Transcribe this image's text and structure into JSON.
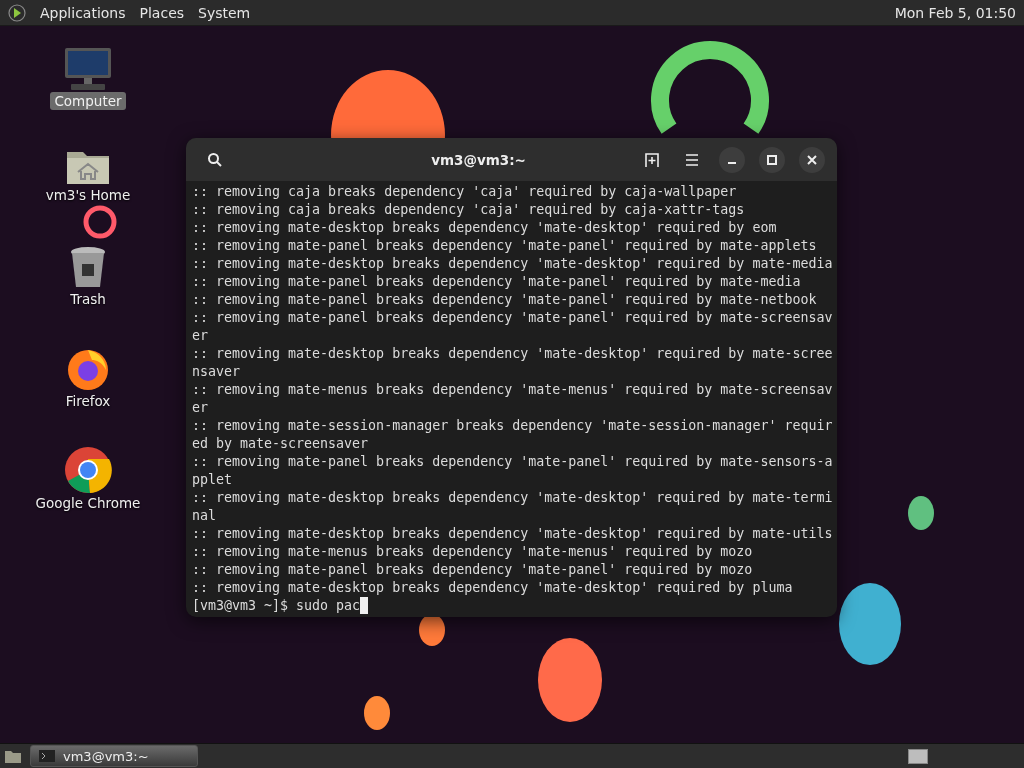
{
  "top_panel": {
    "menus": [
      "Applications",
      "Places",
      "System"
    ],
    "clock": "Mon Feb  5, 01:50"
  },
  "desktop_icons": [
    {
      "kind": "computer",
      "label": "Computer",
      "selected": true
    },
    {
      "kind": "home",
      "label": "vm3's Home",
      "selected": false
    },
    {
      "kind": "trash",
      "label": "Trash",
      "selected": false
    },
    {
      "kind": "firefox",
      "label": "Firefox",
      "selected": false
    },
    {
      "kind": "chrome",
      "label": "Google Chrome",
      "selected": false
    }
  ],
  "terminal": {
    "title": "vm3@vm3:~",
    "lines": [
      ":: removing caja breaks dependency 'caja' required by caja-wallpaper",
      ":: removing caja breaks dependency 'caja' required by caja-xattr-tags",
      ":: removing mate-desktop breaks dependency 'mate-desktop' required by eom",
      ":: removing mate-panel breaks dependency 'mate-panel' required by mate-applets",
      ":: removing mate-desktop breaks dependency 'mate-desktop' required by mate-media",
      ":: removing mate-panel breaks dependency 'mate-panel' required by mate-media",
      ":: removing mate-panel breaks dependency 'mate-panel' required by mate-netbook",
      ":: removing mate-panel breaks dependency 'mate-panel' required by mate-screensav",
      "er",
      ":: removing mate-desktop breaks dependency 'mate-desktop' required by mate-scree",
      "nsaver",
      ":: removing mate-menus breaks dependency 'mate-menus' required by mate-screensav",
      "er",
      ":: removing mate-session-manager breaks dependency 'mate-session-manager' requir",
      "ed by mate-screensaver",
      ":: removing mate-panel breaks dependency 'mate-panel' required by mate-sensors-a",
      "pplet",
      ":: removing mate-desktop breaks dependency 'mate-desktop' required by mate-termi",
      "nal",
      ":: removing mate-desktop breaks dependency 'mate-desktop' required by mate-utils",
      ":: removing mate-menus breaks dependency 'mate-menus' required by mozo",
      ":: removing mate-panel breaks dependency 'mate-panel' required by mozo",
      ":: removing mate-desktop breaks dependency 'mate-desktop' required by pluma"
    ],
    "prompt": "[vm3@vm3 ~]$ sudo pac"
  },
  "taskbar": {
    "tasks": [
      {
        "label": "vm3@vm3:~",
        "selected": true
      }
    ]
  }
}
